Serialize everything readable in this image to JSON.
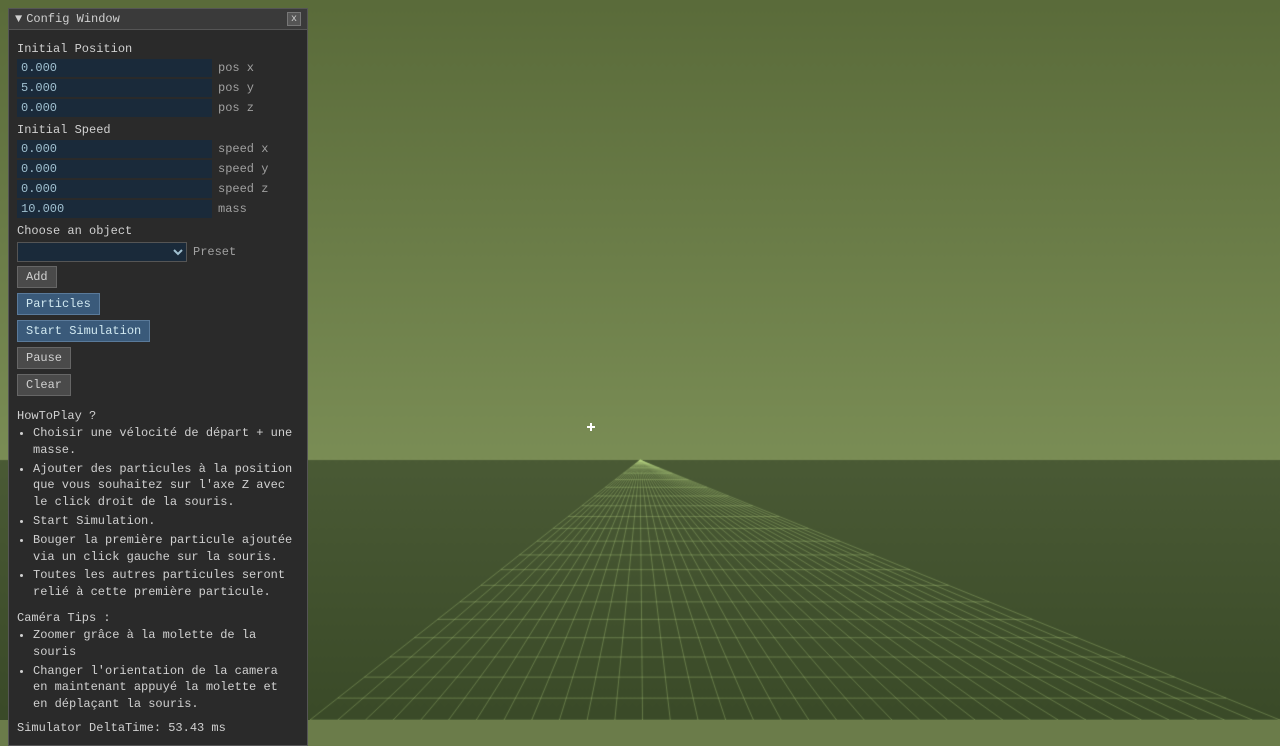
{
  "window": {
    "title": "Config Window",
    "close_label": "x"
  },
  "initial_position": {
    "label": "Initial Position",
    "pos_x": {
      "value": "0.000",
      "label": "pos x"
    },
    "pos_y": {
      "value": "5.000",
      "label": "pos y"
    },
    "pos_z": {
      "value": "0.000",
      "label": "pos z"
    }
  },
  "initial_speed": {
    "label": "Initial Speed",
    "speed_x": {
      "value": "0.000",
      "label": "speed x"
    },
    "speed_y": {
      "value": "0.000",
      "label": "speed y"
    },
    "speed_z": {
      "value": "0.000",
      "label": "speed z"
    }
  },
  "mass": {
    "value": "10.000",
    "label": "mass"
  },
  "choose_object": {
    "label": "Choose an object",
    "preset_label": "Preset",
    "options": [
      ""
    ]
  },
  "buttons": {
    "add": "Add",
    "particles": "Particles",
    "start_simulation": "Start Simulation",
    "pause": "Pause",
    "clear": "Clear"
  },
  "howtoplay": {
    "title": "HowToPlay ?",
    "items": [
      "Choisir une vélocité de départ + une masse.",
      "Ajouter des particules à la position que vous souhaitez sur l'axe Z avec le click droit de la souris.",
      "Start Simulation.",
      "Bouger la première particule ajoutée via un click gauche sur la souris.",
      "Toutes les autres particules seront relié à cette première particule."
    ]
  },
  "camera_tips": {
    "title": "Caméra Tips :",
    "items": [
      "Zoomer grâce à la molette de la souris",
      "Changer l'orientation de la camera en maintenant appuyé la molette et en déplaçant la souris."
    ]
  },
  "simulator": {
    "delta_label": "Simulator DeltaTime: 53.43 ms"
  }
}
